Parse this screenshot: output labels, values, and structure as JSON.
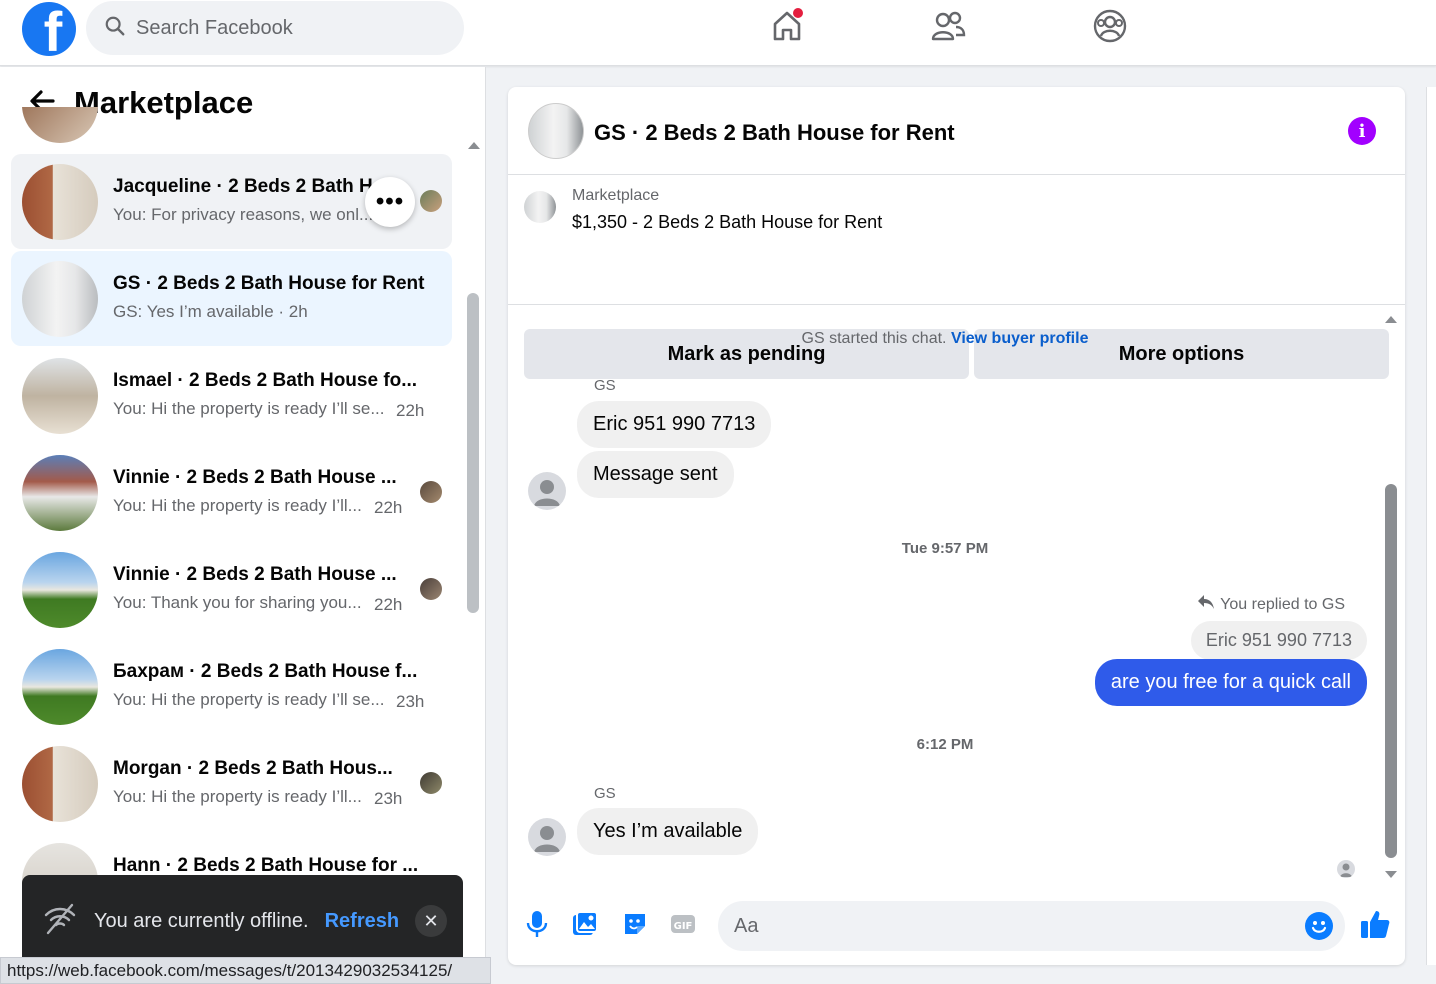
{
  "topbar": {
    "logo_letter": "f",
    "search_placeholder": "Search Facebook"
  },
  "left": {
    "title": "Marketplace",
    "conversations": [
      {
        "name": "Jacqueline · 2 Beds 2 Bath H",
        "snippet": "You: For privacy reasons, we onl...",
        "time": ""
      },
      {
        "name": "GS · 2 Beds 2 Bath House for Rent",
        "snippet": "GS: Yes I’m available · 2h",
        "time": ""
      },
      {
        "name": "Ismael · 2 Beds 2 Bath House fo...",
        "snippet": "You: Hi the property is ready I’ll se...",
        "time": "22h"
      },
      {
        "name": "Vinnie · 2 Beds 2 Bath House ...",
        "snippet": "You: Hi the property is ready I’ll...",
        "time": "22h"
      },
      {
        "name": "Vinnie · 2 Beds 2 Bath House ...",
        "snippet": "You: Thank you for sharing you...",
        "time": "22h"
      },
      {
        "name": "Бахрам · 2 Beds 2 Bath House f...",
        "snippet": "You: Hi the property is ready I’ll se...",
        "time": "23h"
      },
      {
        "name": "Morgan · 2 Beds 2 Bath Hous...",
        "snippet": "You: Hi the property is ready I’ll...",
        "time": "23h"
      },
      {
        "name": "Hann · 2 Beds 2 Bath House for ...",
        "snippet": "",
        "time": ""
      }
    ],
    "more_glyph": "•••"
  },
  "toast": {
    "message": "You are currently offline.",
    "refresh": "Refresh",
    "close": "✕"
  },
  "status_url": "https://web.facebook.com/messages/t/2013429032534125/",
  "chat": {
    "title": "GS · 2 Beds 2 Bath House for Rent",
    "info_glyph": "i",
    "listing_source": "Marketplace",
    "listing_price": "$1,350 - 2 Beds 2 Bath House for Rent",
    "mark_pending": "Mark as pending",
    "more_options": "More options",
    "started_text": "GS started this chat.",
    "view_profile": "View buyer profile",
    "sender1": "GS",
    "msg1": "Eric 951 990 7713",
    "msg2": "Message sent",
    "time1": "Tue 9:57 PM",
    "replied_label": "You replied to GS",
    "quoted": "Eric 951 990 7713",
    "my_msg": "are you free for a quick call",
    "time2": "6:12 PM",
    "sender2": "GS",
    "msg3": "Yes I’m available",
    "composer_placeholder": "Aa"
  },
  "colors": {
    "brand": "#1877f2",
    "my_bubble": "#2f5bea",
    "info": "#a200ff",
    "link": "#0a5ecc"
  }
}
